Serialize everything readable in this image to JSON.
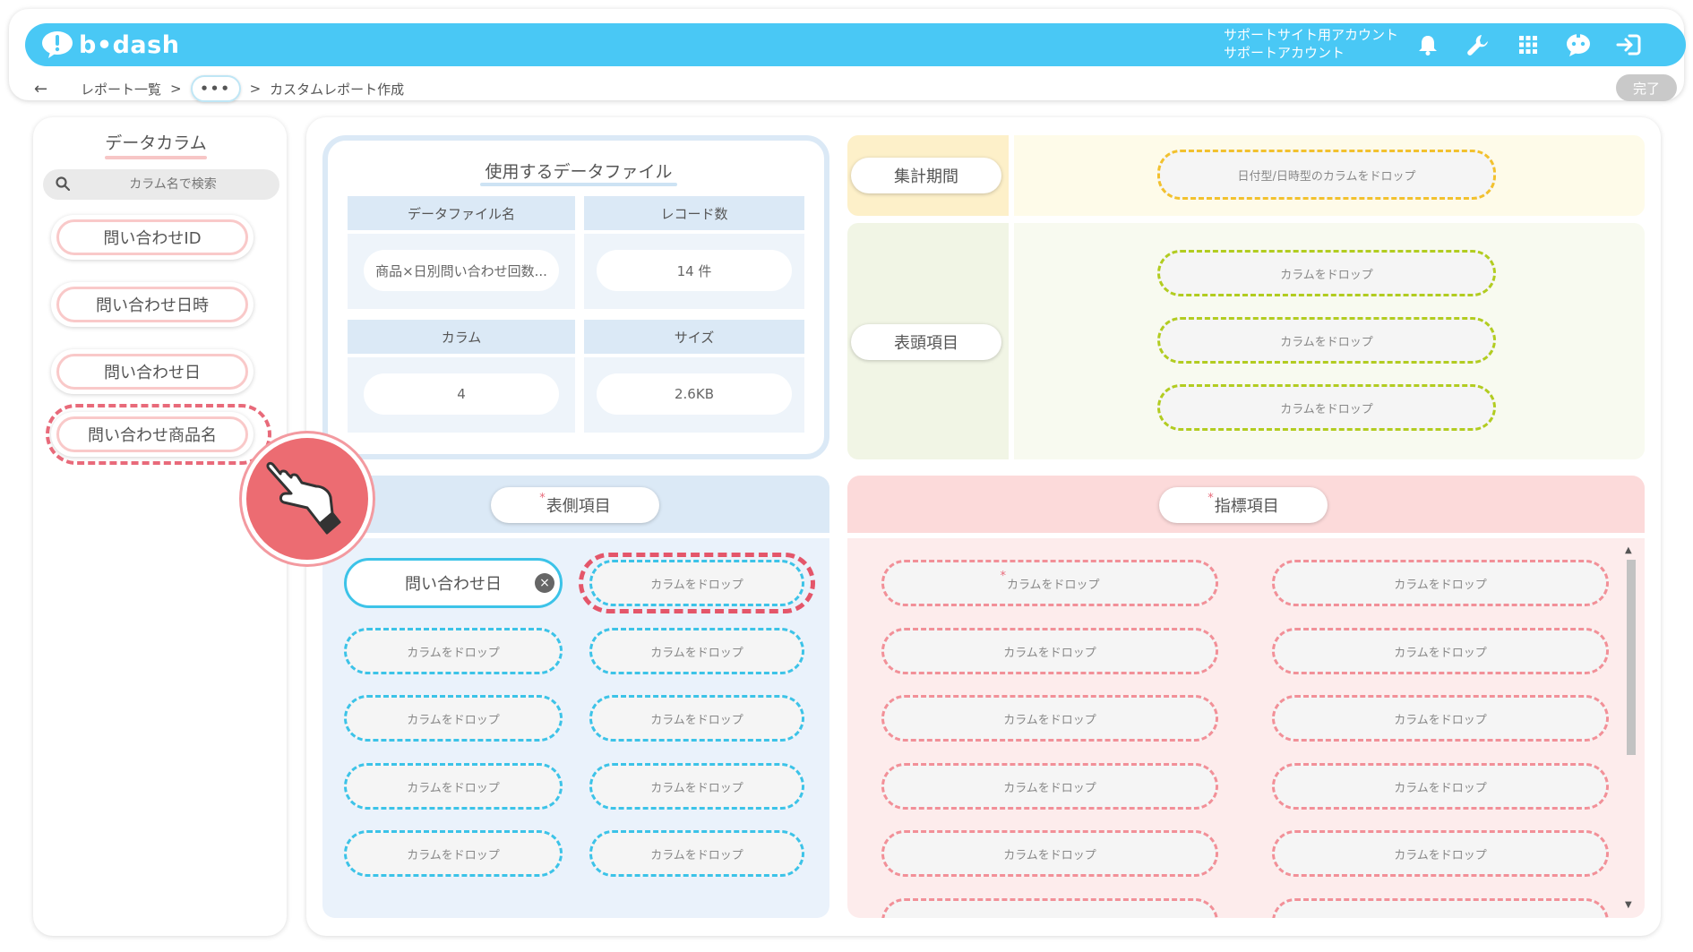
{
  "header": {
    "logo_text": "b•dash",
    "account_line1": "サポートサイト用アカウント",
    "account_line2": "サポートアカウント",
    "icons": [
      "bell-icon",
      "wrench-icon",
      "grid-icon",
      "chat-bot-icon",
      "logout-icon"
    ]
  },
  "breadcrumb": {
    "back": "←",
    "report_list": "レポート一覧",
    "sep1": ">",
    "ellipsis": "•••",
    "sep2": ">",
    "current": "カスタムレポート作成"
  },
  "done_button": "完了",
  "left": {
    "title": "データカラム",
    "search_placeholder": "カラム名で検索",
    "columns": [
      "問い合わせID",
      "問い合わせ日時",
      "問い合わせ日",
      "問い合わせ商品名"
    ]
  },
  "data_file": {
    "title": "使用するデータファイル",
    "name_header": "データファイル名",
    "name_value": "商品×日別問い合わせ回数...",
    "records_header": "レコード数",
    "records_value": "14 件",
    "column_header": "カラム",
    "column_value": "4",
    "size_header": "サイズ",
    "size_value": "2.6KB"
  },
  "period": {
    "label": "集計期間",
    "drop_text": "日付型/日時型のカラムをドロップ"
  },
  "header_items": {
    "label": "表頭項目",
    "drop_text": "カラムをドロップ"
  },
  "side_items": {
    "required_mark": "*",
    "label": "表側項目",
    "filled_value": "問い合わせ日",
    "remove_symbol": "×",
    "drop_text": "カラムをドロップ"
  },
  "metric_items": {
    "required_mark": "*",
    "label": "指標項目",
    "first_drop_text": "カラムをドロップ",
    "drop_text": "カラムをドロップ"
  },
  "colors": {
    "brand": "#49c8f5",
    "highlight": "#e4566a",
    "cursor": "#ec6c72"
  }
}
